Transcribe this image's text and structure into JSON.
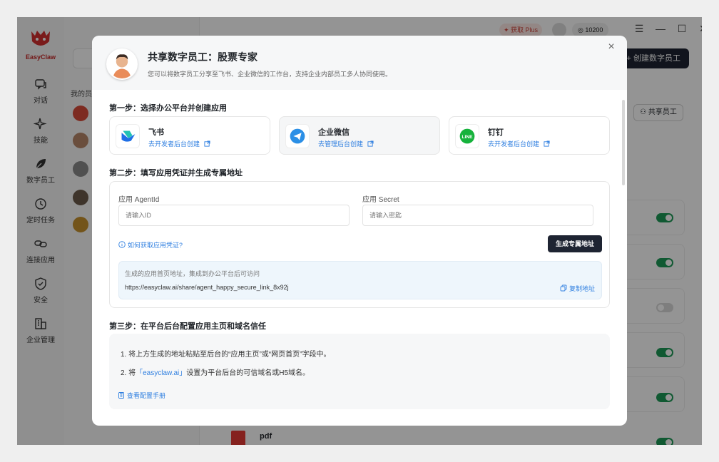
{
  "app": {
    "logo_text": "EasyClaw",
    "nav": [
      {
        "label": "对话",
        "icon": "chat-icon"
      },
      {
        "label": "技能",
        "icon": "sparkle-icon"
      },
      {
        "label": "数字员工",
        "icon": "leaf-icon"
      },
      {
        "label": "定时任务",
        "icon": "clock-icon"
      },
      {
        "label": "连接应用",
        "icon": "link-icon"
      },
      {
        "label": "安全",
        "icon": "shield-icon"
      },
      {
        "label": "企业管理",
        "icon": "building-icon"
      }
    ],
    "employees_title": "我的员工",
    "topbar": {
      "plus_label": "获取 Plus",
      "coins": "10200"
    },
    "create_button": "创建数字员工",
    "share_button": "共享员工",
    "file_name": "pdf"
  },
  "modal": {
    "title": "共享数字员工：股票专家",
    "subtitle": "您可以将数字员工分享至飞书、企业微信的工作台，支持企业内部员工多人协同使用。",
    "step1_title": "第一步：选择办公平台并创建应用",
    "platforms": [
      {
        "name": "飞书",
        "link": "去开发者后台创建",
        "icon": "feishu-icon",
        "color": "#2d6be6"
      },
      {
        "name": "企业微信",
        "link": "去管理后台创建",
        "icon": "wecom-icon",
        "color": "#2b8fe6"
      },
      {
        "name": "钉钉",
        "link": "去开发者后台创建",
        "icon": "line-icon",
        "color": "#15b23b"
      }
    ],
    "step2_title": "第二步：填写应用凭证并生成专属地址",
    "agent_id_label": "应用 AgentId",
    "agent_id_placeholder": "请输入ID",
    "secret_label": "应用 Secret",
    "secret_placeholder": "请输入密匙",
    "help_link": "如何获取应用凭证?",
    "generate_button": "生成专属地址",
    "url_hint": "生成的应用首页地址，集成到办公平台后可访问",
    "url": "https://easyclaw.ai/share/agent_happy_secure_link_8x92j",
    "copy_link": "复制地址",
    "step3_title": "第三步：在平台后台配置应用主页和域名信任",
    "instruction1": "1. 将上方生成的地址粘贴至后台的“应用主页”或“网页首页”字段中。",
    "instruction2_prefix": "2. 将",
    "instruction2_domain": "「easyclaw.ai」",
    "instruction2_suffix": "设置为平台后台的可信域名或H5域名。",
    "manual_link": "查看配置手册"
  }
}
